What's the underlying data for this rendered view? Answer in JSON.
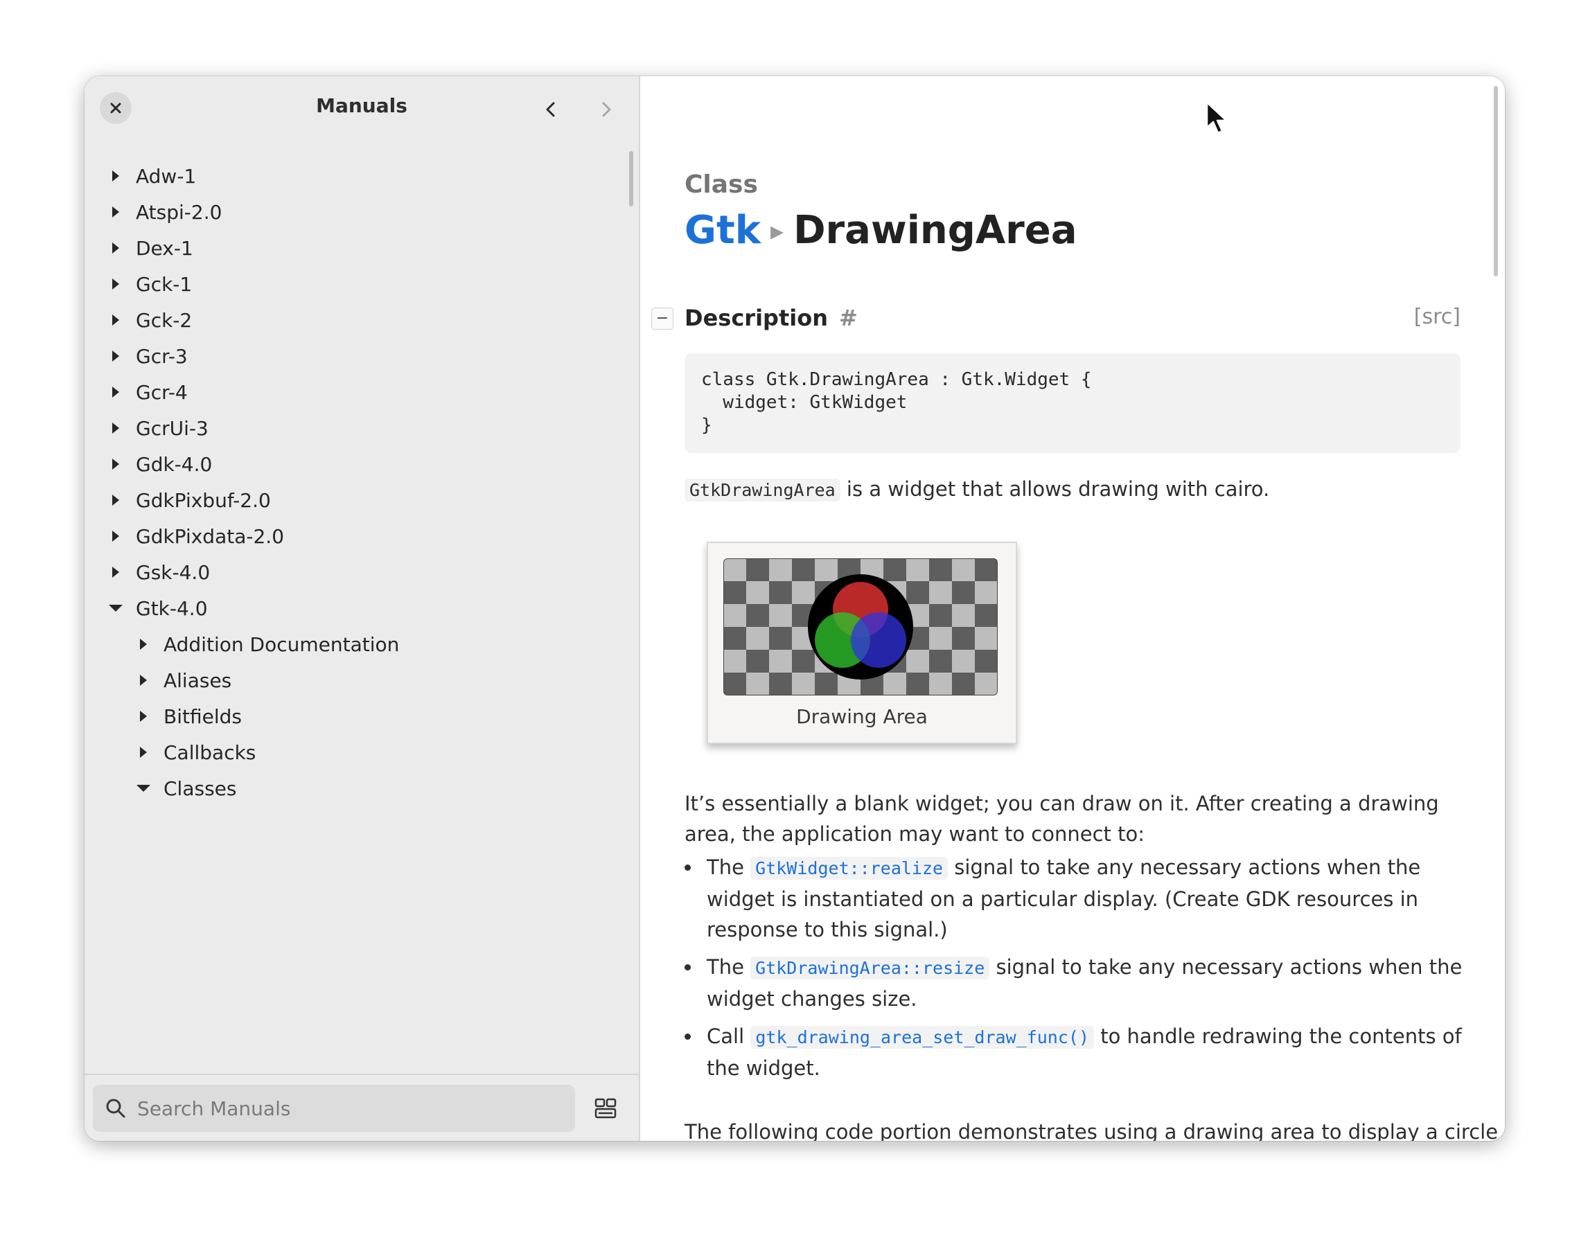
{
  "sidebar": {
    "title": "Manuals",
    "items": [
      {
        "label": "Adw-1",
        "expanded": false,
        "level": 0
      },
      {
        "label": "Atspi-2.0",
        "expanded": false,
        "level": 0
      },
      {
        "label": "Dex-1",
        "expanded": false,
        "level": 0
      },
      {
        "label": "Gck-1",
        "expanded": false,
        "level": 0
      },
      {
        "label": "Gck-2",
        "expanded": false,
        "level": 0
      },
      {
        "label": "Gcr-3",
        "expanded": false,
        "level": 0
      },
      {
        "label": "Gcr-4",
        "expanded": false,
        "level": 0
      },
      {
        "label": "GcrUi-3",
        "expanded": false,
        "level": 0
      },
      {
        "label": "Gdk-4.0",
        "expanded": false,
        "level": 0
      },
      {
        "label": "GdkPixbuf-2.0",
        "expanded": false,
        "level": 0
      },
      {
        "label": "GdkPixdata-2.0",
        "expanded": false,
        "level": 0
      },
      {
        "label": "Gsk-4.0",
        "expanded": false,
        "level": 0
      },
      {
        "label": "Gtk-4.0",
        "expanded": true,
        "level": 0
      },
      {
        "label": "Addition Documentation",
        "expanded": false,
        "level": 1
      },
      {
        "label": "Aliases",
        "expanded": false,
        "level": 1
      },
      {
        "label": "Bitfields",
        "expanded": false,
        "level": 1
      },
      {
        "label": "Callbacks",
        "expanded": false,
        "level": 1
      },
      {
        "label": "Classes",
        "expanded": true,
        "level": 1
      }
    ],
    "search": {
      "placeholder": "Search Manuals",
      "value": ""
    }
  },
  "content": {
    "kind": "Class",
    "namespace": "Gtk",
    "separator": "▸",
    "class_name": "DrawingArea",
    "section": {
      "title": "Description",
      "anchor": "#",
      "src": "[src]",
      "collapse": "−"
    },
    "code": "class Gtk.DrawingArea : Gtk.Widget {\n  widget: GtkWidget\n}",
    "intro": {
      "code": "GtkDrawingArea",
      "text": " is a widget that allows drawing with cairo."
    },
    "figure_caption": "Drawing Area",
    "para2": "It’s essentially a blank widget; you can draw on it. After creating a drawing area, the application may want to connect to:",
    "bullets": [
      {
        "pre": "The ",
        "link": "GtkWidget::realize",
        "post": " signal to take any necessary actions when the widget is instantiated on a particular display. (Create GDK resources in response to this signal.)"
      },
      {
        "pre": "The ",
        "link": "GtkDrawingArea::resize",
        "post": " signal to take any necessary actions when the widget changes size."
      },
      {
        "pre": "Call ",
        "link": "gtk_drawing_area_set_draw_func()",
        "post": " to handle redrawing the contents of the widget."
      }
    ],
    "para3": "The following code portion demonstrates using a drawing area to display a circle in"
  },
  "colors": {
    "accent": "#1c71d8",
    "sidebar_bg": "#ebebeb",
    "content_bg": "#ffffff"
  },
  "icons": {
    "close": "close-icon",
    "back": "chevron-left-icon",
    "forward": "chevron-right-icon",
    "search": "search-icon",
    "layout": "view-layout-icon"
  }
}
